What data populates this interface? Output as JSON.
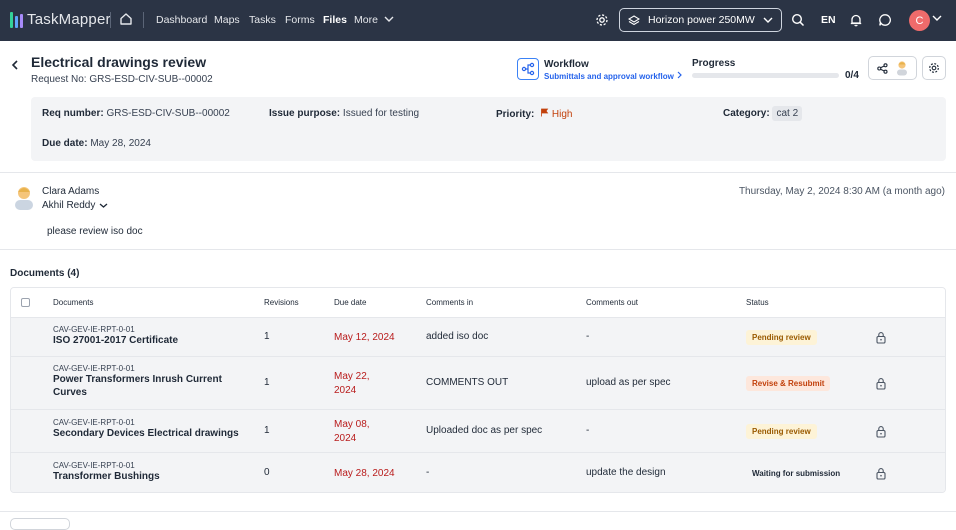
{
  "colors": {
    "topbar": "#2b3445",
    "accent": "#2563eb",
    "due_red": "#b91c1c",
    "priority_high": "#c2410c",
    "pending_bg": "#fdf3d7",
    "pending_fg": "#9a5a00",
    "revise_bg": "#fde7dc",
    "revise_fg": "#c2410c",
    "avatar": "#ef6b6b"
  },
  "topbar": {
    "logo": "TaskMapper",
    "nav": [
      "Dashboard",
      "Maps",
      "Tasks",
      "Forms",
      "Files",
      "More"
    ],
    "active_nav": "Files",
    "project": "Horizon power 250MW",
    "language": "EN",
    "user_initial": "C",
    "icons": [
      "home-icon",
      "gear-icon",
      "layers-icon",
      "search-icon",
      "bell-icon",
      "chat-icon",
      "chevron-down-icon"
    ]
  },
  "header": {
    "title": "Electrical drawings review",
    "request_no": "Request No: GRS-ESD-CIV-SUB--00002",
    "workflow_title": "Workflow",
    "workflow_link": "Submittals and approval workflow",
    "progress_label": "Progress",
    "progress_count": "0/4",
    "progress_fraction": 0
  },
  "info": {
    "req_number_label": "Req number:",
    "req_number": "GRS-ESD-CIV-SUB--00002",
    "issue_purpose_label": "Issue purpose:",
    "issue_purpose": "Issued for testing",
    "priority_label": "Priority:",
    "priority": "High",
    "category_label": "Category:",
    "category": "cat 2",
    "due_date_label": "Due date:",
    "due_date": "May 28, 2024"
  },
  "comment": {
    "author": "Clara Adams",
    "assignee": "Akhil Reddy",
    "timestamp": "Thursday, May 2, 2024 8:30 AM (a month ago)",
    "body": "please review iso doc"
  },
  "documents": {
    "title": "Documents (4)",
    "columns": [
      "Documents",
      "Revisions",
      "Due date",
      "Comments in",
      "Comments out",
      "Status"
    ],
    "rows": [
      {
        "code": "CAV-GEV-IE-RPT-0-01",
        "name": "ISO 27001-2017 Certificate",
        "revisions": "1",
        "due": "May 12, 2024",
        "comments_in": "added iso doc",
        "comments_out": "-",
        "status": "Pending review",
        "status_kind": "pending"
      },
      {
        "code": "CAV-GEV-IE-RPT-0-01",
        "name": "Power Transformers Inrush Current Curves",
        "revisions": "1",
        "due": "May 22, 2024",
        "comments_in": "COMMENTS OUT",
        "comments_out": "upload as per spec",
        "status": "Revise & Resubmit",
        "status_kind": "revise"
      },
      {
        "code": "CAV-GEV-IE-RPT-0-01",
        "name": "Secondary Devices Electrical drawings",
        "revisions": "1",
        "due": "May 08, 2024",
        "comments_in": "Uploaded doc as per spec",
        "comments_out": "-",
        "status": "Pending review",
        "status_kind": "pending"
      },
      {
        "code": "CAV-GEV-IE-RPT-0-01",
        "name": "Transformer Bushings",
        "revisions": "0",
        "due": "May 28, 2024",
        "comments_in": "-",
        "comments_out": "update the design",
        "status": "Waiting for submission",
        "status_kind": "waiting"
      }
    ]
  }
}
